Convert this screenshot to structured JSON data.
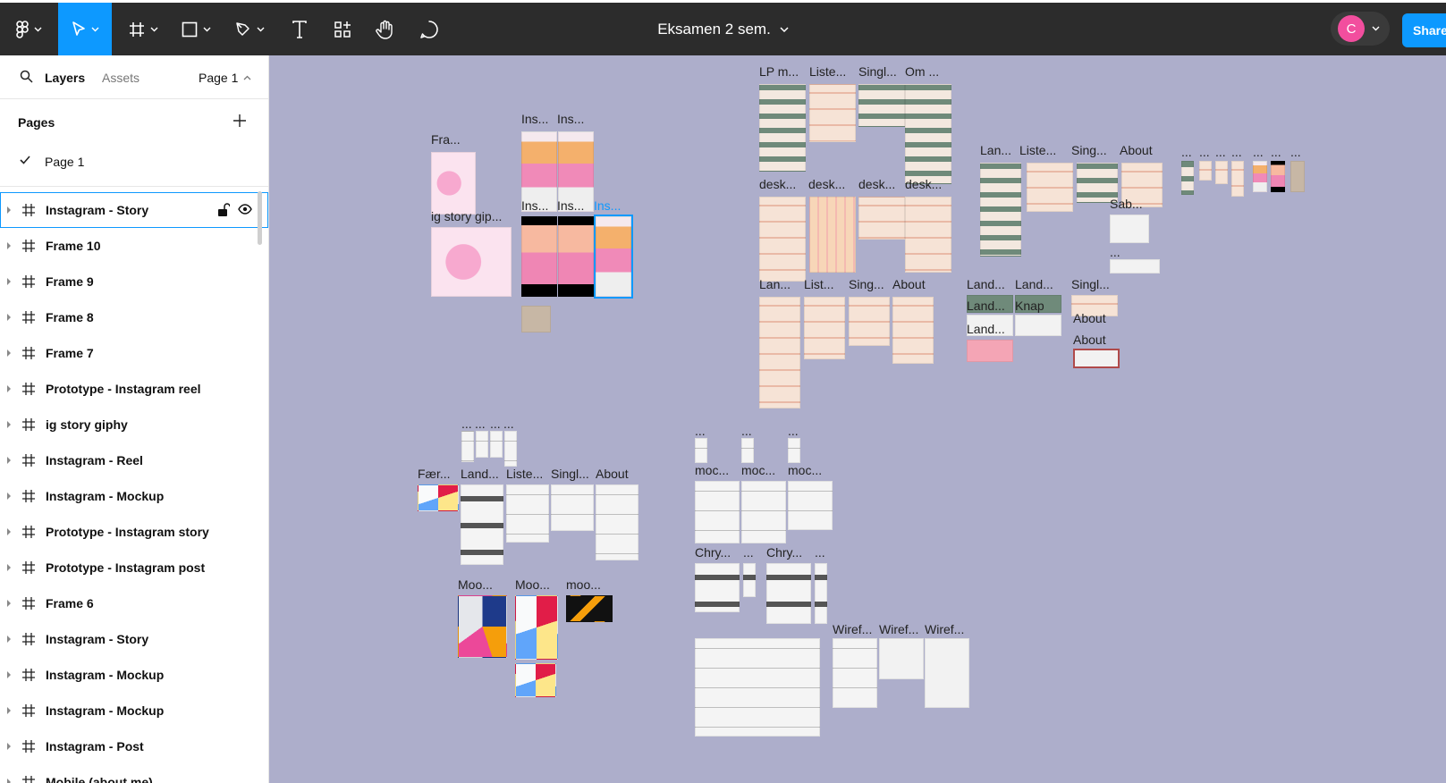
{
  "toolbar": {
    "doc_title": "Eksamen 2 sem.",
    "avatar_initial": "C",
    "share_label": "Share",
    "accent": "#0d99ff",
    "tools": [
      "figma-menu",
      "move-tool",
      "frame-tool",
      "shape-tool",
      "pen-tool",
      "text-tool",
      "resources-tool",
      "hand-tool",
      "comment-tool"
    ]
  },
  "sidebar": {
    "tab_layers": "Layers",
    "tab_assets": "Assets",
    "page_selector": "Page 1",
    "pages_heading": "Pages",
    "pages": [
      "Page 1"
    ],
    "layers": [
      "Instagram - Story",
      "Frame 10",
      "Frame 9",
      "Frame 8",
      "Frame 7",
      "Prototype - Instagram reel",
      "ig story giphy",
      "Instagram - Reel",
      "Instagram - Mockup",
      "Prototype - Instagram story",
      "Prototype - Instagram post",
      "Frame 6",
      "Instagram - Story",
      "Instagram - Mockup",
      "Instagram - Mockup",
      "Instagram - Post",
      "Mobile (about me)"
    ]
  },
  "canvas": {
    "background": "#adaecb",
    "labels": {
      "fra": "Fra...",
      "ins1": "Ins...",
      "ins2": "Ins...",
      "igstory": "ig story gip...",
      "ins3": "Ins...",
      "ins4": "Ins...",
      "ins5": "Ins...",
      "lpm": "LP m...",
      "liste1": "Liste...",
      "singl1": "Singl...",
      "om": "Om ...",
      "desk1": "desk...",
      "desk2": "desk...",
      "desk3": "desk...",
      "desk4": "desk...",
      "lan1": "Lan...",
      "list1": "List...",
      "sing1": "Sing...",
      "about1": "About",
      "lan2": "Lan...",
      "liste2": "Liste...",
      "sing2": "Sing...",
      "about2": "About",
      "sab": "Sab...",
      "dots": "...",
      "land1": "Land...",
      "land2": "Land...",
      "singl2": "Singl...",
      "land3": "Land...",
      "knap": "Knap",
      "about3": "About",
      "land4": "Land...",
      "about4": "About",
      "faer": "Fær...",
      "land5": "Land...",
      "liste3": "Liste...",
      "singl3": "Singl...",
      "about5": "About",
      "moo1": "Moo...",
      "moo2": "Moo...",
      "moo3": "moo...",
      "moc1": "moc...",
      "moc2": "moc...",
      "moc3": "moc...",
      "chry1": "Chry...",
      "chry2": "Chry...",
      "wiref1": "Wiref...",
      "wiref2": "Wiref...",
      "wiref3": "Wiref..."
    }
  }
}
